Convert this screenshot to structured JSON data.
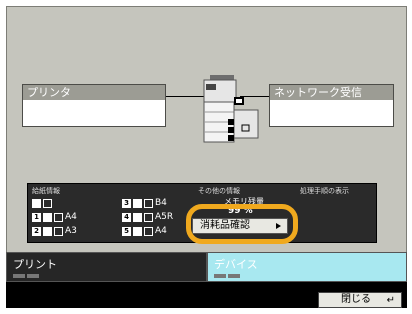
{
  "printer_box": {
    "title": "プリンタ"
  },
  "network_box": {
    "title": "ネットワーク受信"
  },
  "info": {
    "paper_header": "給紙情報",
    "other_header": "その他の情報",
    "procedure_header": "処理手順の表示",
    "trays": [
      {
        "num": "",
        "size": ""
      },
      {
        "num": "3",
        "size": "B4"
      },
      {
        "num": "1",
        "size": "A4"
      },
      {
        "num": "4",
        "size": "A5R"
      },
      {
        "num": "2",
        "size": "A3"
      },
      {
        "num": "5",
        "size": "A4"
      }
    ],
    "memory_label": "メモリ残量",
    "memory_value": "99 %"
  },
  "consumables_button": "消耗品確認",
  "tabs": {
    "print": "プリント",
    "device": "デバイス"
  },
  "close_button": "閉じる",
  "colors": {
    "panel": "#c5c5bd",
    "device_tab": "#a8e8f0",
    "highlight": "#f0a91e"
  }
}
